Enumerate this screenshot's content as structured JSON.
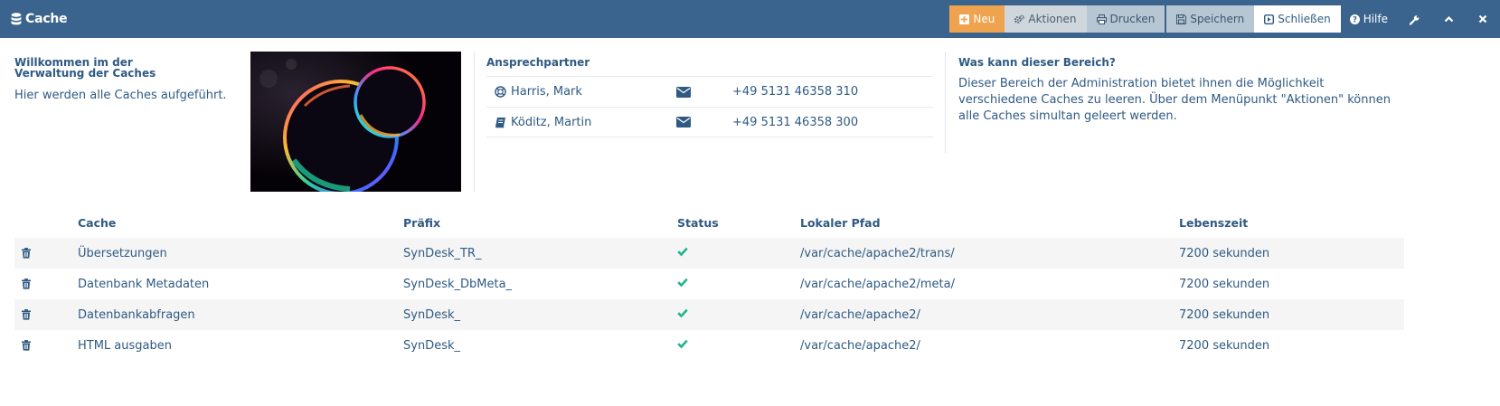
{
  "app": {
    "title": "Cache",
    "icon": "database-icon"
  },
  "toolbar": {
    "neu": "Neu",
    "aktionen": "Aktionen",
    "drucken": "Drucken",
    "speichern": "Speichern",
    "schliessen": "Schließen",
    "hilfe": "Hilfe"
  },
  "welcome": {
    "title": "Willkommen im der Verwaltung der Caches",
    "text": "Hier werden alle Caches aufgeführt."
  },
  "contacts": {
    "title": "Ansprechpartner",
    "items": [
      {
        "name": "Harris, Mark",
        "phone": "+49 5131 46358 310",
        "icon": "lifebuoy-icon"
      },
      {
        "name": "Köditz, Martin",
        "phone": "+49 5131 46358 300",
        "icon": "book-icon"
      }
    ]
  },
  "area": {
    "title": "Was kann dieser Bereich?",
    "text": "Dieser Bereich der Administration bietet ihnen die Möglichkeit verschiedene Caches zu leeren. Über dem Menüpunkt \"Aktionen\" können alle Caches simultan geleert werden."
  },
  "table": {
    "headers": {
      "cache": "Cache",
      "prefix": "Präfix",
      "status": "Status",
      "path": "Lokaler Pfad",
      "lifetime": "Lebenszeit"
    },
    "rows": [
      {
        "cache": "Übersetzungen",
        "prefix": "SynDesk_TR_",
        "path": "/var/cache/apache2/trans/",
        "lifetime": "7200 sekunden"
      },
      {
        "cache": "Datenbank Metadaten",
        "prefix": "SynDesk_DbMeta_",
        "path": "/var/cache/apache2/meta/",
        "lifetime": "7200 sekunden"
      },
      {
        "cache": "Datenbankabfragen",
        "prefix": "SynDesk_",
        "path": "/var/cache/apache2/",
        "lifetime": "7200 sekunden"
      },
      {
        "cache": "HTML ausgaben",
        "prefix": "SynDesk_",
        "path": "/var/cache/apache2/",
        "lifetime": "7200 sekunden"
      }
    ]
  },
  "colors": {
    "header": "#3a648d",
    "accent": "#f0a34e",
    "text": "#2f5a83",
    "status_ok": "#1fb58c"
  }
}
